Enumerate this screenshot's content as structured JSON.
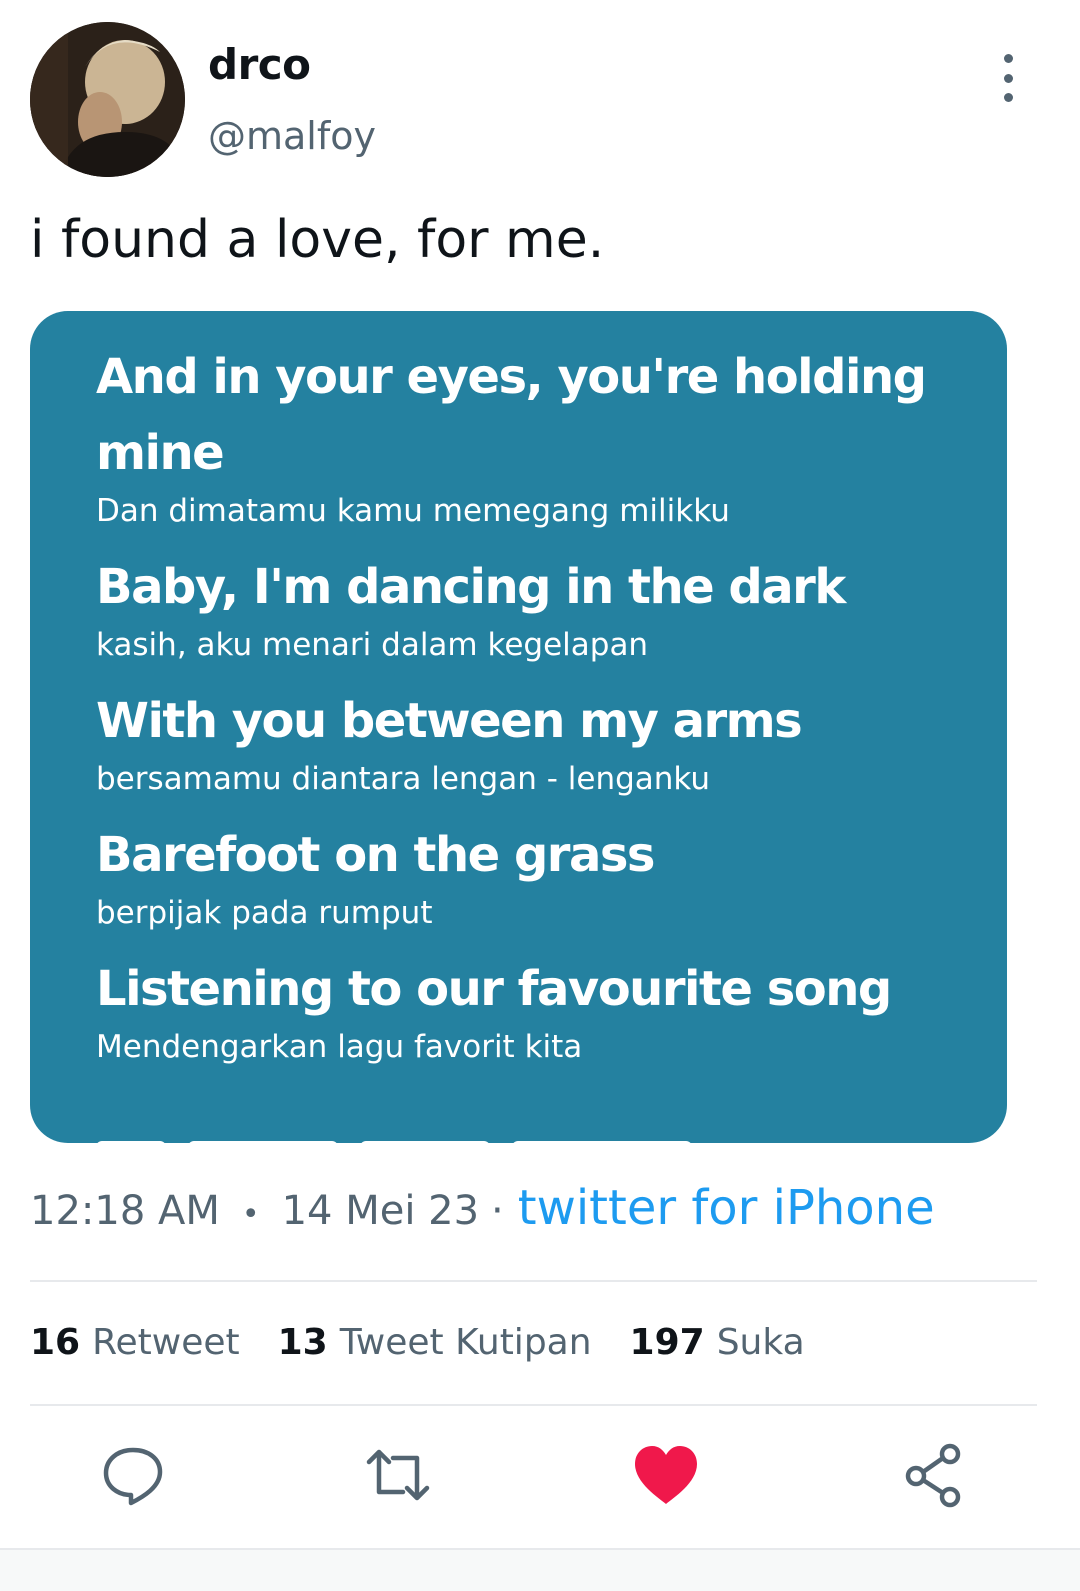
{
  "user": {
    "display_name": "drco",
    "handle": "@malfoy"
  },
  "tweet": {
    "text": "i found a love, for me."
  },
  "lyrics": [
    {
      "en": "And in your eyes, you're holding mine",
      "id": "Dan dimatamu kamu memegang milikku"
    },
    {
      "en": "Baby, I'm dancing in the dark",
      "id": "kasih, aku menari dalam kegelapan"
    },
    {
      "en": "With you between my arms",
      "id": "bersamamu diantara lengan - lenganku"
    },
    {
      "en": "Barefoot on the grass",
      "id": "berpijak pada rumput"
    },
    {
      "en": "Listening to our favourite song",
      "id": "Mendengarkan lagu favorit kita"
    }
  ],
  "meta": {
    "time": "12:18 AM",
    "separator": "•",
    "date": "14 Mei 23",
    "separator2": "·",
    "source": "twitter for iPhone"
  },
  "stats": {
    "retweets_count": "16",
    "retweets_label": "Retweet",
    "quotes_count": "13",
    "quotes_label": "Tweet Kutipan",
    "likes_count": "197",
    "likes_label": "Suka"
  },
  "icons": {
    "reply": "reply-icon",
    "retweet": "retweet-icon",
    "like": "heart-icon",
    "share": "share-icon",
    "more": "more-vertical-icon"
  },
  "colors": {
    "card_background": "#2481a0",
    "link": "#1d9bf0",
    "like_active": "#f91880",
    "muted_text": "#536471"
  }
}
